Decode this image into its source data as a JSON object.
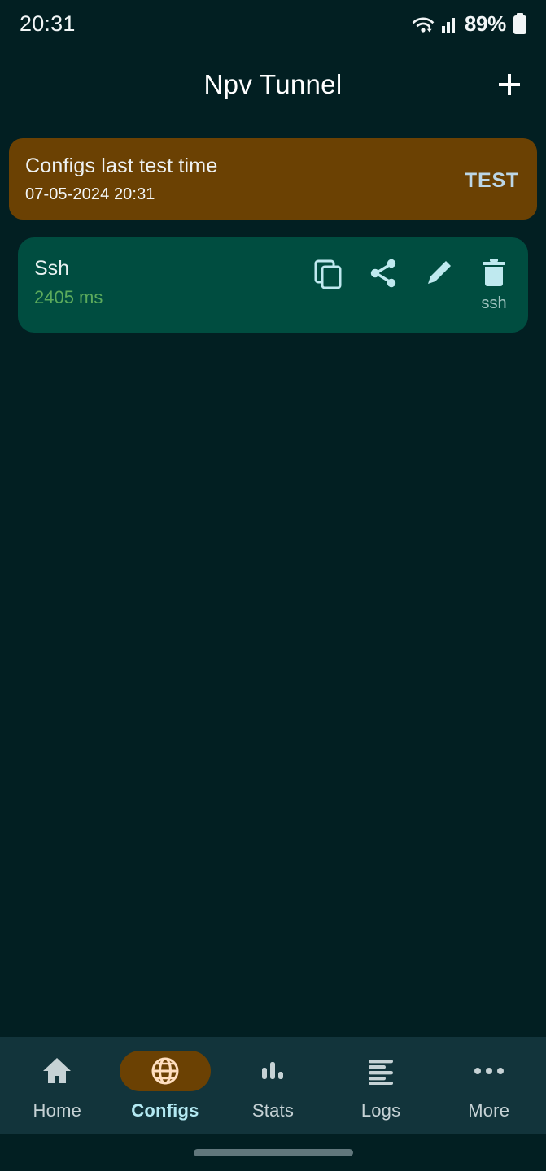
{
  "status_bar": {
    "clock": "20:31",
    "battery_percent": "89%",
    "wifi_icon": "wifi-icon",
    "cellular_icon": "cellular-signal-icon",
    "battery_icon": "battery-icon"
  },
  "app_bar": {
    "title": "Npv Tunnel",
    "add_icon": "plus-icon"
  },
  "test_card": {
    "title": "Configs last test time",
    "timestamp": "07-05-2024 20:31",
    "action_label": "TEST",
    "background_color": "#6b4103"
  },
  "configs": [
    {
      "name": "Ssh",
      "ping": "2405 ms",
      "ping_color": "#5cab5c",
      "background_color": "#004d40",
      "actions": [
        {
          "icon": "copy-icon",
          "label": ""
        },
        {
          "icon": "share-icon",
          "label": ""
        },
        {
          "icon": "edit-pencil-icon",
          "label": ""
        },
        {
          "icon": "delete-trash-icon",
          "label": "ssh"
        }
      ]
    }
  ],
  "bottom_nav": {
    "active_index": 1,
    "active_pill_color": "#6b4103",
    "active_label_color": "#b3e9f2",
    "items": [
      {
        "label": "Home",
        "icon": "home-icon"
      },
      {
        "label": "Configs",
        "icon": "globe-icon"
      },
      {
        "label": "Stats",
        "icon": "bar-chart-icon"
      },
      {
        "label": "Logs",
        "icon": "list-lines-icon"
      },
      {
        "label": "More",
        "icon": "ellipsis-icon"
      }
    ]
  },
  "gesture_bar": {
    "handle": "gesture-handle"
  }
}
